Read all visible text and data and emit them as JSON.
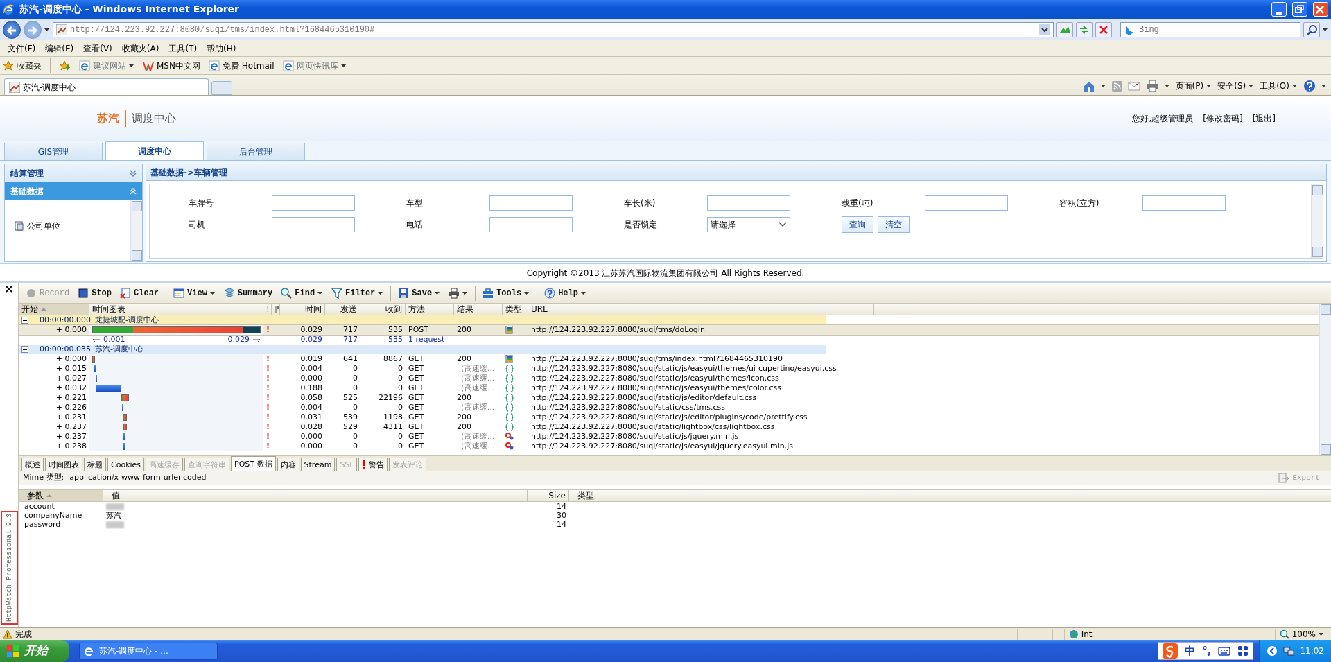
{
  "window": {
    "title": "苏汽-调度中心 - Windows Internet Explorer"
  },
  "address_bar": {
    "url": "http://124.223.92.227:8080/suqi/tms/index.html?1684465310190#"
  },
  "search": {
    "placeholder": "Bing"
  },
  "menu": [
    "文件(F)",
    "编辑(E)",
    "查看(V)",
    "收藏夹(A)",
    "工具(T)",
    "帮助(H)"
  ],
  "favorites_bar": {
    "label": "收藏夹",
    "links": [
      {
        "label": "建议网站",
        "dropdown": true,
        "disabled": true
      },
      {
        "label": "MSN中文网",
        "dropdown": false,
        "disabled": false
      },
      {
        "label": "免费 Hotmail",
        "dropdown": false,
        "disabled": false
      },
      {
        "label": "网页快讯库",
        "dropdown": true,
        "disabled": true
      }
    ]
  },
  "browser_tabs": [
    {
      "label": "苏汽-调度中心",
      "selected": true
    }
  ],
  "command_bar": [
    {
      "label": "页面(P)"
    },
    {
      "label": "安全(S)"
    },
    {
      "label": "工具(O)"
    }
  ],
  "page": {
    "brand": "苏汽",
    "subtitle": "调度中心",
    "user_links": [
      "您好,超级管理员",
      "[修改密码]",
      "[退出]"
    ],
    "tabs": [
      {
        "label": "GIS管理",
        "selected": false
      },
      {
        "label": "调度中心",
        "selected": true
      },
      {
        "label": "后台管理",
        "selected": false
      }
    ],
    "accordion": [
      {
        "label": "结算管理",
        "expanded": false
      },
      {
        "label": "基础数据",
        "expanded": true,
        "items": [
          "公司单位"
        ]
      }
    ],
    "breadcrumb": "基础数据->车辆管理",
    "fields": [
      {
        "label": "车牌号",
        "kind": "text"
      },
      {
        "label": "车型",
        "kind": "text"
      },
      {
        "label": "车长(米)",
        "kind": "text"
      },
      {
        "label": "载重(吨)",
        "kind": "text"
      },
      {
        "label": "容积(立方)",
        "kind": "text"
      },
      {
        "label": "司机",
        "kind": "text"
      },
      {
        "label": "电话",
        "kind": "text"
      },
      {
        "label": "是否锁定",
        "kind": "select",
        "value": "请选择"
      }
    ],
    "buttons": [
      "查询",
      "清空"
    ],
    "footer": "Copyright ©2013 江苏苏汽国际物流集团有限公司  All Rights Reserved."
  },
  "httpwatch": {
    "toolbar": [
      {
        "kind": "record",
        "label": "Record",
        "disabled": true,
        "dropdown": false
      },
      {
        "kind": "stop",
        "label": "Stop",
        "disabled": false,
        "dropdown": false
      },
      {
        "kind": "clear",
        "label": "Clear",
        "disabled": false,
        "dropdown": false
      },
      {
        "kind": "separator"
      },
      {
        "kind": "view",
        "label": "View",
        "disabled": false,
        "dropdown": true
      },
      {
        "kind": "summary",
        "label": "Summary",
        "disabled": false,
        "dropdown": false
      },
      {
        "kind": "find",
        "label": "Find",
        "disabled": false,
        "dropdown": true
      },
      {
        "kind": "filter",
        "label": "Filter",
        "disabled": false,
        "dropdown": true
      },
      {
        "kind": "separator"
      },
      {
        "kind": "save",
        "label": "Save",
        "disabled": false,
        "dropdown": true
      },
      {
        "kind": "print",
        "disabled": false,
        "dropdown": true
      },
      {
        "kind": "separator"
      },
      {
        "kind": "tools",
        "label": "Tools",
        "disabled": false,
        "dropdown": true
      },
      {
        "kind": "separator"
      },
      {
        "kind": "help",
        "label": "Help",
        "disabled": false,
        "dropdown": true
      }
    ],
    "columns": [
      {
        "label": "开始",
        "sorted": true
      },
      {
        "label": "时间图表",
        "sorted": false
      },
      {
        "label": "!",
        "sorted": false
      },
      {
        "kind": "flag",
        "sorted": false
      },
      {
        "label": "时间",
        "sorted": false
      },
      {
        "label": "发送",
        "sorted": false
      },
      {
        "label": "收到",
        "sorted": false
      },
      {
        "label": "方法",
        "sorted": false
      },
      {
        "label": "结果",
        "sorted": false
      },
      {
        "label": "类型",
        "sorted": false
      },
      {
        "label": "URL",
        "sorted": false
      }
    ],
    "groups": [
      {
        "start": "00:00:00.000",
        "title": "龙捷城配-调度中心",
        "expanded": true,
        "color": "#f9efb6",
        "summary": {
          "first": "0.001",
          "last": "0.029",
          "time": "0.029",
          "sent": "717",
          "received": "535",
          "requests": "1 request"
        },
        "entries": [
          {
            "start": "+ 0.000",
            "warning": "!",
            "time": "0.029",
            "sent": "717",
            "received": "535",
            "method": "POST",
            "result": "200",
            "kind": "page",
            "url": "http://124.223.92.227:8080/suqi/tms/doLogin",
            "selected": true,
            "cached": false
          }
        ]
      },
      {
        "start": "00:00:00.035",
        "title": "苏汽-调度中心",
        "expanded": true,
        "color": "#dce9f8",
        "entries": [
          {
            "start": "+ 0.000",
            "warning": "!",
            "time": "0.019",
            "sent": "641",
            "received": "8867",
            "method": "GET",
            "result": "200",
            "kind": "page",
            "url": "http://124.223.92.227:8080/suqi/tms/index.html?1684465310190",
            "selected": false,
            "cached": false
          },
          {
            "start": "+ 0.015",
            "warning": "!",
            "time": "0.004",
            "sent": "0",
            "received": "0",
            "method": "GET",
            "result": "（高速缓...",
            "kind": "css",
            "url": "http://124.223.92.227:8080/suqi/static/js/easyui/themes/ui-cupertino/easyui.css",
            "selected": false,
            "cached": true
          },
          {
            "start": "+ 0.027",
            "warning": "!",
            "time": "0.000",
            "sent": "0",
            "received": "0",
            "method": "GET",
            "result": "（高速缓...",
            "kind": "css",
            "url": "http://124.223.92.227:8080/suqi/static/js/easyui/themes/icon.css",
            "selected": false,
            "cached": true
          },
          {
            "start": "+ 0.032",
            "warning": "!",
            "time": "0.188",
            "sent": "0",
            "received": "0",
            "method": "GET",
            "result": "（高速缓...",
            "kind": "css",
            "url": "http://124.223.92.227:8080/suqi/static/js/easyui/themes/color.css",
            "selected": false,
            "cached": true
          },
          {
            "start": "+ 0.221",
            "warning": "!",
            "time": "0.058",
            "sent": "525",
            "received": "22196",
            "method": "GET",
            "result": "200",
            "kind": "css",
            "url": "http://124.223.92.227:8080/suqi/static/js/editor/default.css",
            "selected": false,
            "cached": false
          },
          {
            "start": "+ 0.226",
            "warning": "!",
            "time": "0.004",
            "sent": "0",
            "received": "0",
            "method": "GET",
            "result": "（高速缓...",
            "kind": "css",
            "url": "http://124.223.92.227:8080/suqi/static/css/tms.css",
            "selected": false,
            "cached": true
          },
          {
            "start": "+ 0.231",
            "warning": "!",
            "time": "0.031",
            "sent": "539",
            "received": "1198",
            "method": "GET",
            "result": "200",
            "kind": "css",
            "url": "http://124.223.92.227:8080/suqi/static/js/editor/plugins/code/prettify.css",
            "selected": false,
            "cached": false
          },
          {
            "start": "+ 0.237",
            "warning": "!",
            "time": "0.028",
            "sent": "529",
            "received": "4311",
            "method": "GET",
            "result": "200",
            "kind": "css",
            "url": "http://124.223.92.227:8080/suqi/static/lightbox/css/lightbox.css",
            "selected": false,
            "cached": false
          },
          {
            "start": "+ 0.237",
            "warning": "!",
            "time": "0.000",
            "sent": "0",
            "received": "0",
            "method": "GET",
            "result": "（高速缓...",
            "kind": "script",
            "url": "http://124.223.92.227:8080/suqi/static/js/jquery.min.js",
            "selected": false,
            "cached": true
          },
          {
            "start": "+ 0.238",
            "warning": "!",
            "time": "0.000",
            "sent": "0",
            "received": "0",
            "method": "GET",
            "result": "（高速缓...",
            "kind": "script",
            "url": "http://124.223.92.227:8080/suqi/static/js/easyui/jquery.easyui.min.js",
            "selected": false,
            "cached": true
          }
        ]
      }
    ],
    "detail_tabs": [
      {
        "label": "概述",
        "selected": false,
        "disabled": false,
        "kind": "plain"
      },
      {
        "label": "时间图表",
        "selected": false,
        "disabled": false,
        "kind": "plain"
      },
      {
        "label": "标题",
        "selected": false,
        "disabled": false,
        "kind": "plain"
      },
      {
        "label": "Cookies",
        "selected": false,
        "disabled": false,
        "kind": "plain"
      },
      {
        "label": "高速缓存",
        "selected": false,
        "disabled": true,
        "kind": "plain"
      },
      {
        "label": "查询字符串",
        "selected": false,
        "disabled": true,
        "kind": "plain"
      },
      {
        "label": "POST 数据",
        "selected": true,
        "disabled": false,
        "kind": "plain"
      },
      {
        "label": "内容",
        "selected": false,
        "disabled": false,
        "kind": "plain"
      },
      {
        "label": "Stream",
        "selected": false,
        "disabled": false,
        "kind": "plain"
      },
      {
        "label": "SSL",
        "selected": false,
        "disabled": true,
        "kind": "plain"
      },
      {
        "label": "警告",
        "selected": false,
        "disabled": false,
        "kind": "warning"
      },
      {
        "label": "发表评论",
        "selected": false,
        "disabled": true,
        "kind": "plain"
      }
    ],
    "mime": {
      "label": "Mime 类型:",
      "value": "application/x-www-form-urlencoded"
    },
    "export": {
      "label": "Export",
      "disabled": true
    },
    "param_columns": [
      {
        "label": "参数",
        "sorted": true
      },
      {
        "label": "值",
        "sorted": false
      },
      {
        "label": "Size",
        "sorted": false
      },
      {
        "label": "类型",
        "sorted": false
      }
    ],
    "params": [
      {
        "name": "account",
        "redacted": true,
        "size": "14"
      },
      {
        "name": "companyName",
        "redacted": false,
        "value": "苏汽",
        "size": "30"
      },
      {
        "name": "password",
        "redacted": true,
        "size": "14"
      }
    ],
    "side_label": "HttpWatch Professional 9.3"
  },
  "status_bar": {
    "text": "完成",
    "zone": "Int",
    "zoom": "100%"
  },
  "ime": {
    "mode": "中",
    "punct": "°,"
  },
  "taskbar": {
    "start": "开始",
    "tasks": [
      {
        "label": "苏汽-调度中心 - ...",
        "selected": false
      }
    ],
    "clock": "11:02"
  }
}
